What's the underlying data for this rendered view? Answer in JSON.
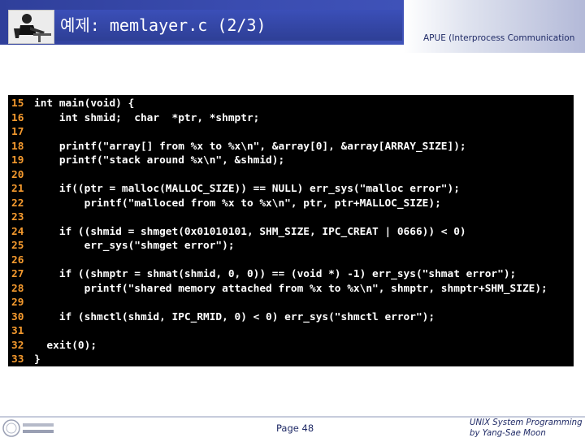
{
  "header": {
    "title": "예제: memlayer.c (2/3)",
    "subtitle": "APUE (Interprocess Communication"
  },
  "code": {
    "lines": [
      {
        "n": "15",
        "text": "int main(void) {"
      },
      {
        "n": "16",
        "text": "    int shmid;  char  *ptr, *shmptr;"
      },
      {
        "n": "17",
        "text": ""
      },
      {
        "n": "18",
        "text": "    printf(\"array[] from %x to %x\\n\", &array[0], &array[ARRAY_SIZE]);"
      },
      {
        "n": "19",
        "text": "    printf(\"stack around %x\\n\", &shmid);"
      },
      {
        "n": "20",
        "text": ""
      },
      {
        "n": "21",
        "text": "    if((ptr = malloc(MALLOC_SIZE)) == NULL) err_sys(\"malloc error\");"
      },
      {
        "n": "22",
        "text": "        printf(\"malloced from %x to %x\\n\", ptr, ptr+MALLOC_SIZE);"
      },
      {
        "n": "23",
        "text": ""
      },
      {
        "n": "24",
        "text": "    if ((shmid = shmget(0x01010101, SHM_SIZE, IPC_CREAT | 0666)) < 0)"
      },
      {
        "n": "25",
        "text": "        err_sys(\"shmget error\");"
      },
      {
        "n": "26",
        "text": ""
      },
      {
        "n": "27",
        "text": "    if ((shmptr = shmat(shmid, 0, 0)) == (void *) -1) err_sys(\"shmat error\");"
      },
      {
        "n": "28",
        "text": "        printf(\"shared memory attached from %x to %x\\n\", shmptr, shmptr+SHM_SIZE);"
      },
      {
        "n": "29",
        "text": ""
      },
      {
        "n": "30",
        "text": "    if (shmctl(shmid, IPC_RMID, 0) < 0) err_sys(\"shmctl error\");"
      },
      {
        "n": "31",
        "text": ""
      },
      {
        "n": "32",
        "text": "  exit(0);"
      },
      {
        "n": "33",
        "text": "}"
      }
    ]
  },
  "footer": {
    "page": "Page 48",
    "course_line1": "UNIX System Programming",
    "course_line2": "by Yang-Sae Moon"
  },
  "icons": {
    "header_logo": "person-at-desk-icon",
    "footer_logo": "university-seal-icon"
  }
}
